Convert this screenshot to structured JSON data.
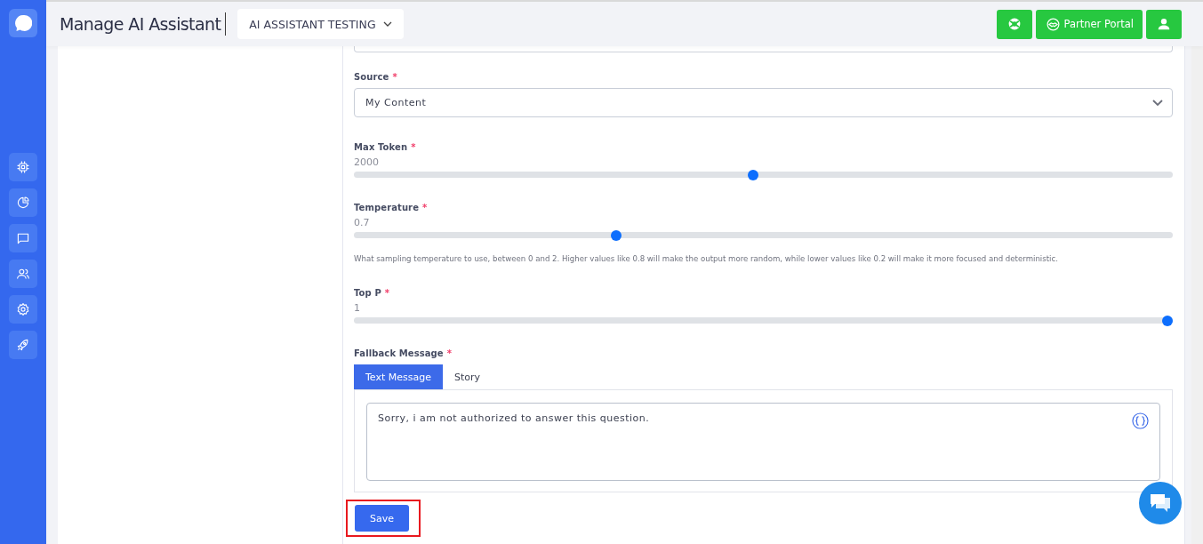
{
  "sidebar": {
    "items": [
      {
        "kind": "chip",
        "selected": false
      },
      {
        "kind": "chart",
        "selected": false
      },
      {
        "kind": "chat",
        "selected": false
      },
      {
        "kind": "users",
        "selected": false
      },
      {
        "kind": "gear",
        "selected": false
      },
      {
        "kind": "rocket",
        "selected": false
      }
    ]
  },
  "header": {
    "title": "Manage AI Assistant",
    "assistant_dropdown": "AI ASSISTANT TESTING",
    "buttons": [
      {
        "kind": "lifebuoy"
      },
      {
        "kind": "handshake",
        "label": "Partner Portal"
      },
      {
        "kind": "user"
      }
    ]
  },
  "form": {
    "source": {
      "label": "Source",
      "required_mark": "*",
      "value": "My Content"
    },
    "sliders": [
      {
        "label": "Max Token",
        "required_mark": "*",
        "reading": "2000",
        "level": 0.487
      },
      {
        "label": "Temperature",
        "required_mark": "*",
        "reading": "0.7",
        "level": 0.318,
        "help": "What sampling temperature to use, between 0 and 2. Higher values like 0.8 will make the output more random, while lower values like 0.2 will make it more focused and deterministic."
      },
      {
        "label": "Top P",
        "required_mark": "*",
        "reading": "1",
        "level": 1
      }
    ],
    "fallback": {
      "label": "Fallback Message",
      "required_mark": "*",
      "tabs": [
        {
          "label": "Text Message",
          "selected": true
        },
        {
          "label": "Story",
          "selected": false
        }
      ],
      "message": "Sorry, i am not authorized to answer this question."
    },
    "save_button": "Save",
    "save_highlighted": true
  }
}
